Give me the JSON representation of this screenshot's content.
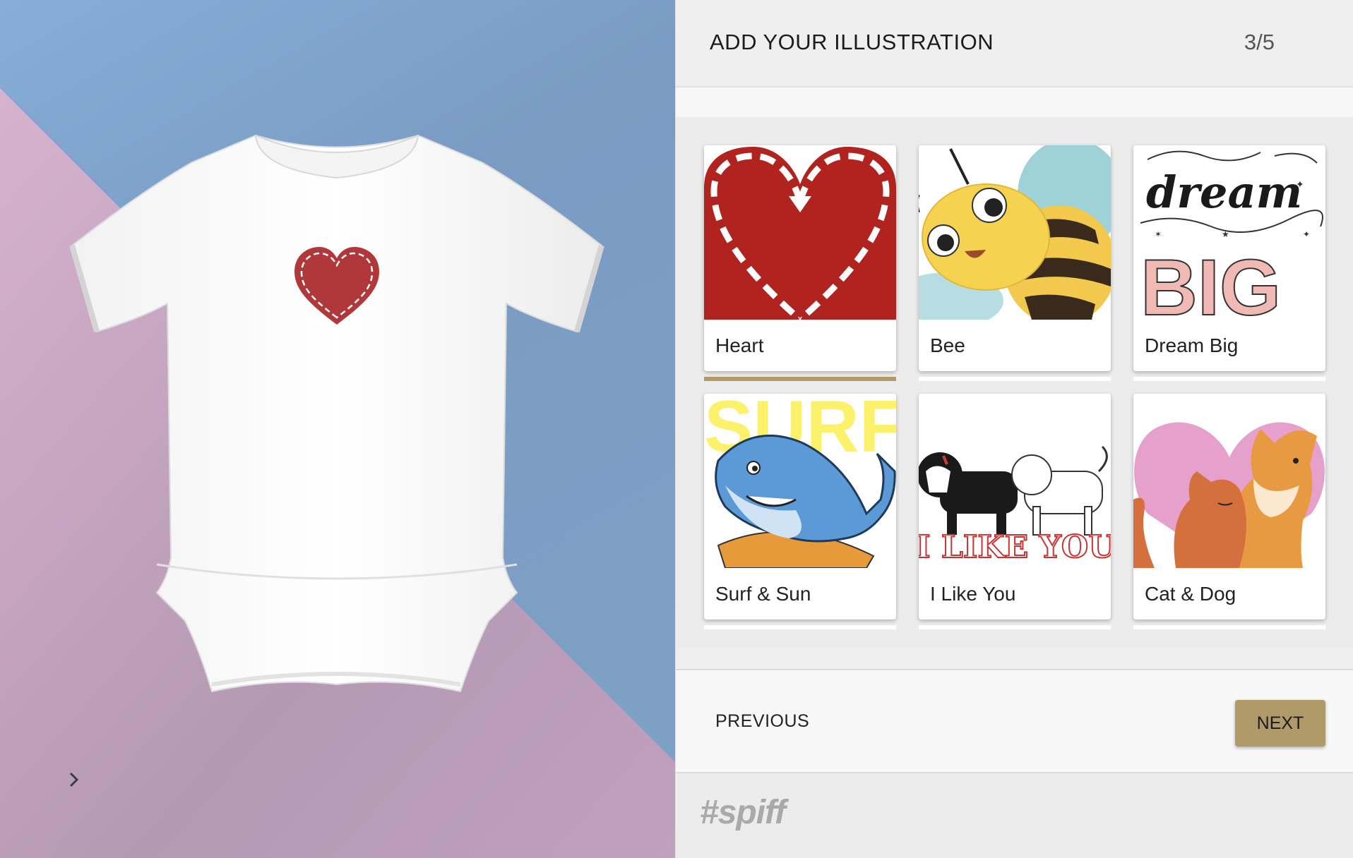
{
  "header": {
    "title": "ADD YOUR ILLUSTRATION",
    "step": "3/5"
  },
  "illustrations": [
    {
      "label": "Heart",
      "selected": true
    },
    {
      "label": "Bee",
      "selected": false
    },
    {
      "label": "Dream Big",
      "selected": false
    },
    {
      "label": "Surf & Sun",
      "selected": false
    },
    {
      "label": "I Like You",
      "selected": false
    },
    {
      "label": "Cat & Dog",
      "selected": false
    }
  ],
  "thumb_text": {
    "dream": "dream",
    "big": "BIG",
    "surf": "SURF",
    "like_you": "I LIKE YOU"
  },
  "nav": {
    "previous_label": "PREVIOUS",
    "next_label": "NEXT"
  },
  "footer": {
    "logo_text": "#spiff"
  },
  "preview": {
    "product": "onesie",
    "print": "heart-icon"
  },
  "colors": {
    "accent": "#b09a6a",
    "heart_red": "#b0251e",
    "background_blue": "#7fa1c8",
    "background_pink": "#c9a4c2"
  }
}
